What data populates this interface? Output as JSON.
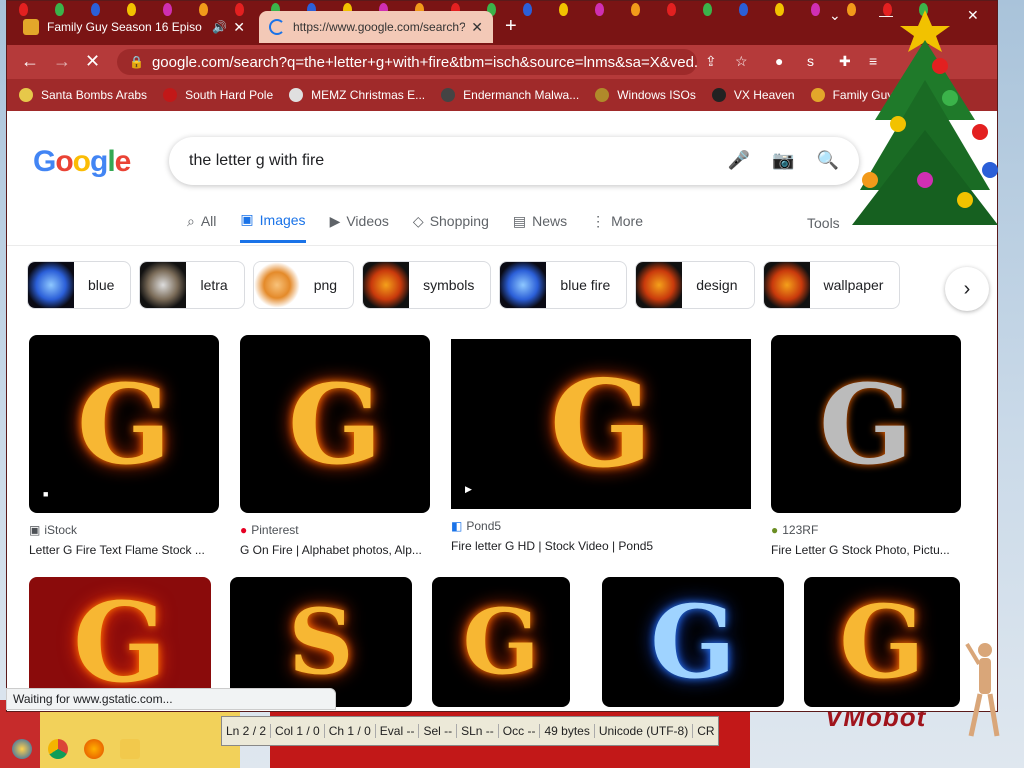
{
  "browser": {
    "tabs": [
      {
        "title": "Family Guy Season 16 Episo",
        "icon": "speaker-icon"
      },
      {
        "title": "https://www.google.com/search?",
        "active": true
      }
    ],
    "address": "google.com/search?q=the+letter+g+with+fire&tbm=isch&source=lnms&sa=X&ved...",
    "bookmarks": [
      {
        "label": "Santa Bombs Arabs",
        "color": "#e6c84a"
      },
      {
        "label": "South Hard Pole",
        "color": "#c21818"
      },
      {
        "label": "MEMZ Christmas E...",
        "color": "#e0e0e0"
      },
      {
        "label": "Endermanch Malwa...",
        "color": "#444444"
      },
      {
        "label": "Windows ISOs",
        "color": "#b08a2a"
      },
      {
        "label": "VX Heaven",
        "color": "#222222"
      },
      {
        "label": "Family Guy",
        "color": "#e3a72a"
      }
    ]
  },
  "google": {
    "logo": "Google",
    "query": "the letter g with fire",
    "tabs": [
      "All",
      "Images",
      "Videos",
      "Shopping",
      "News",
      "More"
    ],
    "active_tab": "Images",
    "tools": "Tools",
    "chips": [
      {
        "label": "blue",
        "style": "blue"
      },
      {
        "label": "letra",
        "style": "gray"
      },
      {
        "label": "png",
        "style": "pale"
      },
      {
        "label": "symbols",
        "style": "fire"
      },
      {
        "label": "blue fire",
        "style": "blue"
      },
      {
        "label": "design",
        "style": "fire"
      },
      {
        "label": "wallpaper",
        "style": "fire"
      }
    ],
    "results_row1": [
      {
        "source": "iStock",
        "caption": "Letter G Fire Text Flame Stock ...",
        "glyph": "G"
      },
      {
        "source": "Pinterest",
        "caption": "G On Fire | Alphabet photos, Alp...",
        "glyph": "G"
      },
      {
        "source": "Pond5",
        "caption": "Fire letter G HD | Stock Video | Pond5",
        "glyph": "G"
      },
      {
        "source": "123RF",
        "caption": "Fire Letter G Stock Photo, Pictu...",
        "glyph": "G"
      }
    ],
    "results_row2": [
      {
        "glyph": "G"
      },
      {
        "glyph": "S"
      },
      {
        "glyph": "G"
      },
      {
        "glyph": "G",
        "style": "blue"
      },
      {
        "glyph": "G"
      }
    ]
  },
  "status": "Waiting for www.gstatic.com...",
  "editor_status": {
    "ln": "Ln 2 / 2",
    "col": "Col 1 / 0",
    "ch": "Ch 1 / 0",
    "eval": "Eval --",
    "sel": "Sel --",
    "sln": "SLn --",
    "occ": "Occ --",
    "size": "49 bytes",
    "encoding": "Unicode (UTF-8)",
    "eol": "CR"
  },
  "desktop": {
    "vmobot": "VMobot"
  },
  "colors": {
    "accent": "#1a73e8",
    "chrome": "#7a1414"
  }
}
